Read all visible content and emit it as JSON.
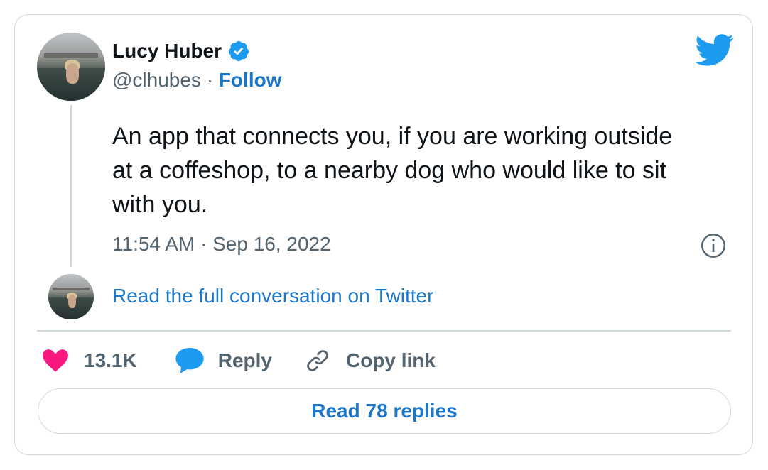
{
  "tweet": {
    "author_name": "Lucy Huber",
    "handle": "@clhubes",
    "separator": " · ",
    "follow_label": "Follow",
    "text": "An app that connects you, if you are working outside at a coffeshop, to a nearby dog who would like to sit with you.",
    "timestamp": "11:54 AM · Sep 16, 2022",
    "read_full_label": "Read the full conversation on Twitter",
    "likes": "13.1K",
    "reply_label": "Reply",
    "copy_link_label": "Copy link",
    "read_replies_label": "Read 78 replies"
  },
  "colors": {
    "link_blue": "#1d77c8",
    "twitter_blue": "#1d9bf0",
    "heart_pink": "#f91880",
    "muted_gray": "#536471",
    "border": "#cfd9de"
  },
  "icons": {
    "verified": "verified-badge-icon",
    "brand": "twitter-bird-icon",
    "info": "info-icon",
    "like": "heart-icon",
    "reply": "speech-bubble-icon",
    "copy": "link-icon"
  }
}
